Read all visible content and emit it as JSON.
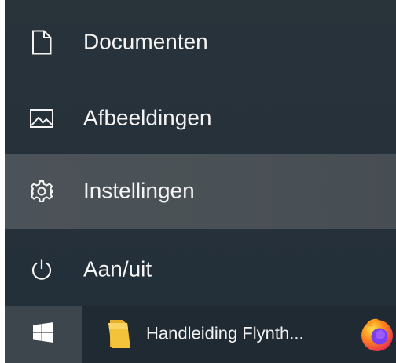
{
  "start_menu": {
    "items": [
      {
        "label": "Documenten",
        "icon": "document-icon"
      },
      {
        "label": "Afbeeldingen",
        "icon": "pictures-icon"
      },
      {
        "label": "Instellingen",
        "icon": "gear-icon",
        "highlighted": true
      },
      {
        "label": "Aan/uit",
        "icon": "power-icon"
      }
    ]
  },
  "taskbar": {
    "start_icon": "windows-logo-icon",
    "open_window": {
      "label": "Handleiding Flynth...",
      "icon": "folder-icon"
    },
    "pinned_app_icon": "firefox-icon"
  },
  "colors": {
    "menu_background": "#26313a",
    "highlight": "#4a5156",
    "taskbar_background": "#1f2a33",
    "start_button_background": "#3d464d",
    "text": "#f4f4f4",
    "folder_yellow": "#f3c33c"
  }
}
